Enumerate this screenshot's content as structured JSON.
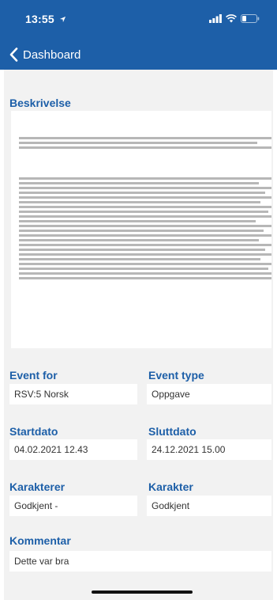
{
  "status_bar": {
    "time": "13:55"
  },
  "nav": {
    "back_label": "Dashboard"
  },
  "description": {
    "title": "Beskrivelse"
  },
  "fields": {
    "event_for": {
      "label": "Event for",
      "value": "RSV:5 Norsk"
    },
    "event_type": {
      "label": "Event type",
      "value": "Oppgave"
    },
    "startdato": {
      "label": "Startdato",
      "value": "04.02.2021 12.43"
    },
    "sluttdato": {
      "label": "Sluttdato",
      "value": "24.12.2021 15.00"
    },
    "karakterer": {
      "label": "Karakterer",
      "value": "Godkjent -"
    },
    "karakter": {
      "label": "Karakter",
      "value": "Godkjent"
    },
    "kommentar": {
      "label": "Kommentar",
      "value": "Dette var bra"
    }
  },
  "colors": {
    "header": "#1d5fa8",
    "label": "#1d5fa8",
    "background": "#f2f2f2"
  },
  "icons": [
    "location-arrow-icon",
    "signal-icon",
    "wifi-icon",
    "battery-icon",
    "chevron-left-icon"
  ]
}
